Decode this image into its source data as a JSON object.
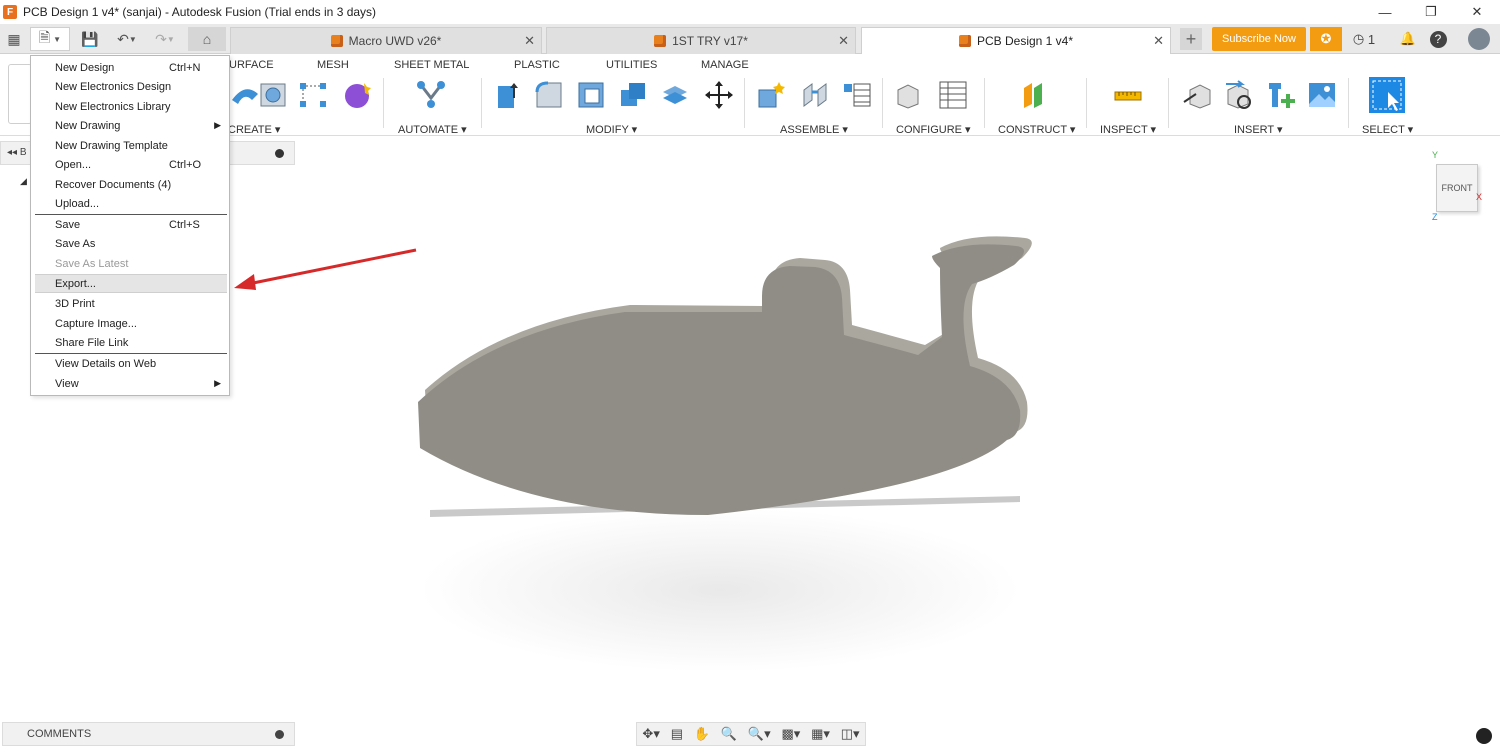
{
  "window": {
    "title": "PCB Design 1 v4* (sanjai) - Autodesk Fusion (Trial ends in 3 days)",
    "logo_letter": "F"
  },
  "tabs": [
    {
      "label": "Macro UWD v26*",
      "active": false
    },
    {
      "label": "1ST TRY v17*",
      "active": false
    },
    {
      "label": "PCB Design 1 v4*",
      "active": true
    }
  ],
  "header_right": {
    "subscribe_label": "Subscribe Now",
    "jobs_count": "1"
  },
  "toolbar": {
    "tabs": [
      "URFACE",
      "MESH",
      "SHEET METAL",
      "PLASTIC",
      "UTILITIES",
      "MANAGE"
    ],
    "groups": [
      "CREATE ▾",
      "AUTOMATE ▾",
      "MODIFY ▾",
      "ASSEMBLE ▾",
      "CONFIGURE ▾",
      "CONSTRUCT ▾",
      "INSPECT ▾",
      "INSERT ▾",
      "SELECT ▾"
    ]
  },
  "file_menu": {
    "items": [
      {
        "label": "New Design",
        "shortcut": "Ctrl+N"
      },
      {
        "label": "New Electronics Design",
        "shortcut": ""
      },
      {
        "label": "New Electronics Library",
        "shortcut": ""
      },
      {
        "label": "New Drawing",
        "shortcut": "",
        "submenu": true
      },
      {
        "label": "New Drawing Template",
        "shortcut": ""
      },
      {
        "label": "Open...",
        "shortcut": "Ctrl+O"
      },
      {
        "label": "Recover Documents (4)",
        "shortcut": ""
      },
      {
        "label": "Upload...",
        "shortcut": ""
      },
      {
        "label": "Save",
        "shortcut": "Ctrl+S"
      },
      {
        "label": "Save As",
        "shortcut": ""
      },
      {
        "label": "Save As Latest",
        "shortcut": "",
        "disabled": true
      },
      {
        "label": "Export...",
        "shortcut": "",
        "hover": true
      },
      {
        "label": "3D Print",
        "shortcut": ""
      },
      {
        "label": "Capture Image...",
        "shortcut": ""
      },
      {
        "label": "Share File Link",
        "shortcut": ""
      },
      {
        "label": "View Details on Web",
        "shortcut": ""
      },
      {
        "label": "View",
        "shortcut": "",
        "submenu": true
      }
    ]
  },
  "panels": {
    "comments_label": "COMMENTS",
    "browser_collapse": "◂◂ B"
  },
  "viewcube": {
    "face_label": "FRONT",
    "x": "X",
    "y": "Y",
    "z": "Z"
  },
  "colors": {
    "accent_orange": "#f39c12",
    "model_gray": "#8f8d86",
    "annotation_arrow": "#d62a2a"
  }
}
